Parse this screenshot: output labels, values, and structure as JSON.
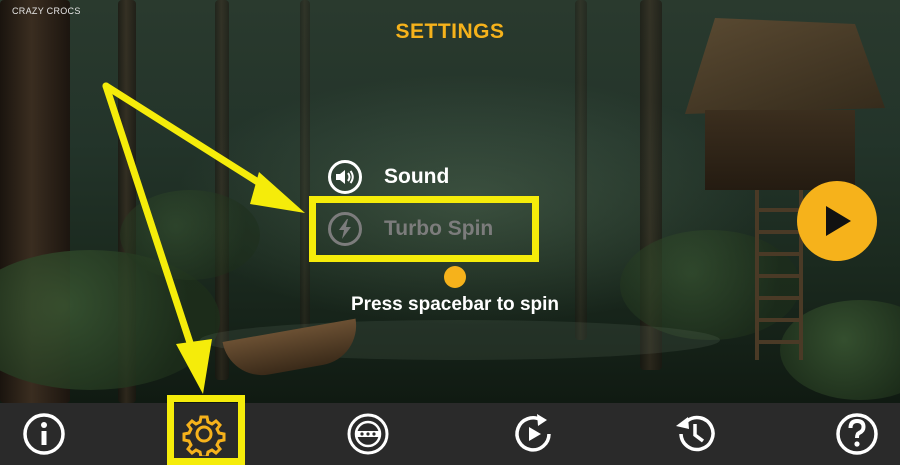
{
  "game": {
    "brand": "CRAZY CROCS"
  },
  "settings": {
    "title": "SETTINGS",
    "sound_label": "Sound",
    "turbo_label": "Turbo Spin",
    "hint": "Press spacebar to spin"
  },
  "colors": {
    "accent": "#f6b21b",
    "highlight": "#f5ec0a",
    "bar": "#2a2a2a",
    "dim": "#7c7c7c"
  },
  "bottom_bar": {
    "icons": [
      "info-icon",
      "gear-icon",
      "autoplay-icon",
      "replay-icon",
      "history-icon",
      "help-icon"
    ],
    "active": "gear-icon"
  }
}
